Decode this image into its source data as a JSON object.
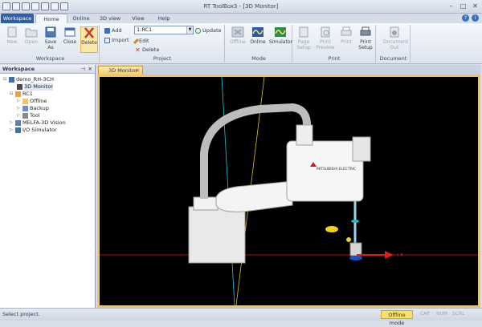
{
  "window": {
    "title": "RT ToolBox3 - [3D Monitor]"
  },
  "ribbon_tabs": [
    "Workspace",
    "Home",
    "Online",
    "3D view",
    "View",
    "Help"
  ],
  "workspace_group": {
    "label": "Workspace",
    "buttons": [
      "New",
      "Open",
      "Save As",
      "Close",
      "Delete"
    ]
  },
  "project_group": {
    "label": "Project",
    "add": "Add",
    "import": "Import",
    "combo_value": "1:RC1",
    "update": "Update",
    "edit": "Edit",
    "delete": "Delete"
  },
  "mode_group": {
    "label": "Mode",
    "buttons": [
      "Offline",
      "Online",
      "Simulator"
    ]
  },
  "print_group": {
    "label": "Print",
    "buttons": [
      "Page Setup",
      "Print Preview",
      "Print",
      "Print Setup"
    ]
  },
  "document_group": {
    "label": "Document",
    "buttons": [
      "Document Out"
    ]
  },
  "workspace_panel": {
    "title": "Workspace",
    "tree": [
      "demo_RH-3CH",
      "3D Monitor",
      "RC1",
      "Offline",
      "Backup",
      "Tool",
      "MELFA-3D Vision",
      "I/O Simulator"
    ]
  },
  "document_tab": {
    "label": "3D Monitor"
  },
  "scene": {
    "axis_label": "+X",
    "robot_brand": "MITSUBISHI ELECTRIC"
  },
  "statusbar": {
    "message": "Select project.",
    "mode": "Offline mode",
    "indicators": [
      "CAP",
      "NUM",
      "SCRL"
    ]
  }
}
